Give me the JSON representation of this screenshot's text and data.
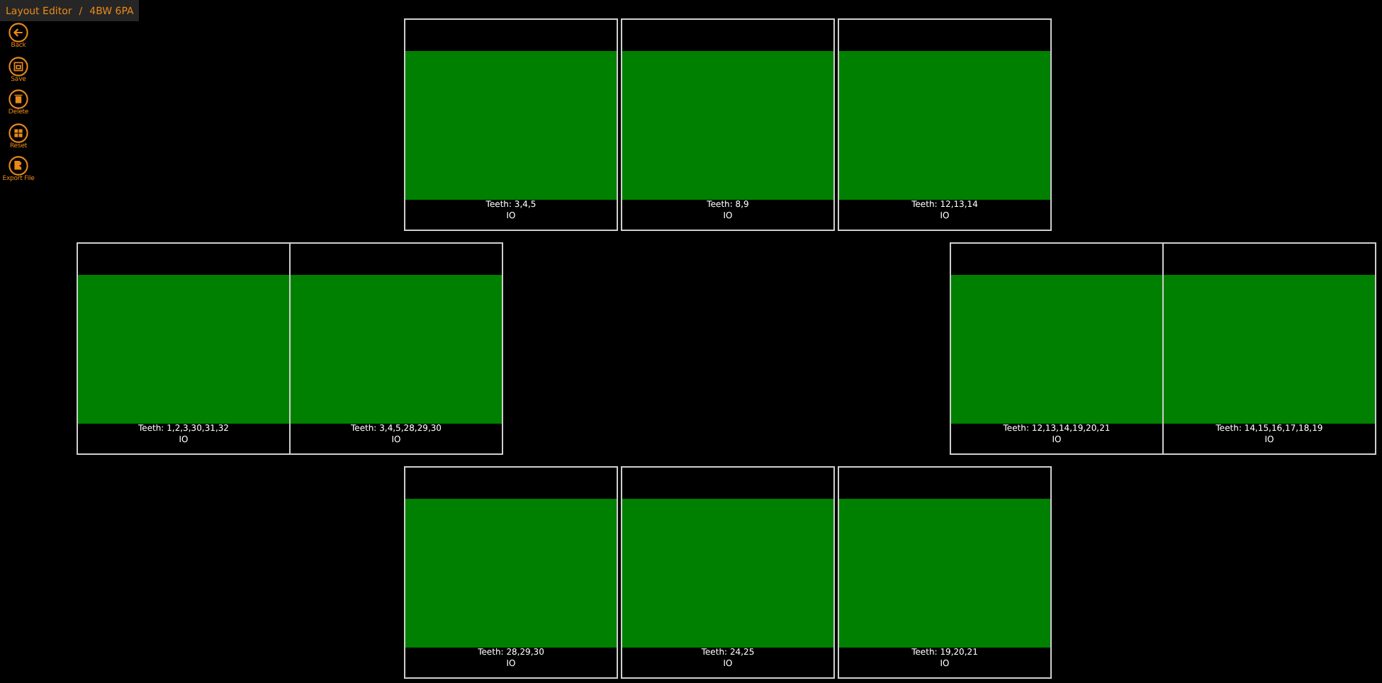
{
  "breadcrumb": {
    "parts": [
      "Layout Editor",
      "/",
      "4BW 6PA"
    ]
  },
  "toolbar": [
    {
      "label": "Back",
      "kind": "back"
    },
    {
      "label": "Save",
      "kind": "save"
    },
    {
      "label": "Delete",
      "kind": "delete"
    },
    {
      "label": "Reset",
      "kind": "reset"
    },
    {
      "label": "Export File",
      "kind": "export"
    }
  ],
  "rows": [
    {
      "kind": "center",
      "tiles": [
        {
          "teeth": "Teeth: 3,4,5",
          "status": "IO"
        },
        {
          "teeth": "Teeth: 8,9",
          "status": "IO"
        },
        {
          "teeth": "Teeth: 12,13,14",
          "status": "IO"
        }
      ]
    },
    {
      "kind": "split",
      "groups": [
        [
          {
            "teeth": "Teeth: 1,2,3,30,31,32",
            "status": "IO"
          },
          {
            "teeth": "Teeth: 3,4,5,28,29,30",
            "status": "IO"
          }
        ],
        [
          {
            "teeth": "Teeth: 12,13,14,19,20,21",
            "status": "IO"
          },
          {
            "teeth": "Teeth: 14,15,16,17,18,19",
            "status": "IO"
          }
        ]
      ]
    },
    {
      "kind": "center",
      "tiles": [
        {
          "teeth": "Teeth: 28,29,30",
          "status": "IO"
        },
        {
          "teeth": "Teeth: 24,25",
          "status": "IO"
        },
        {
          "teeth": "Teeth: 19,20,21",
          "status": "IO"
        }
      ]
    }
  ]
}
